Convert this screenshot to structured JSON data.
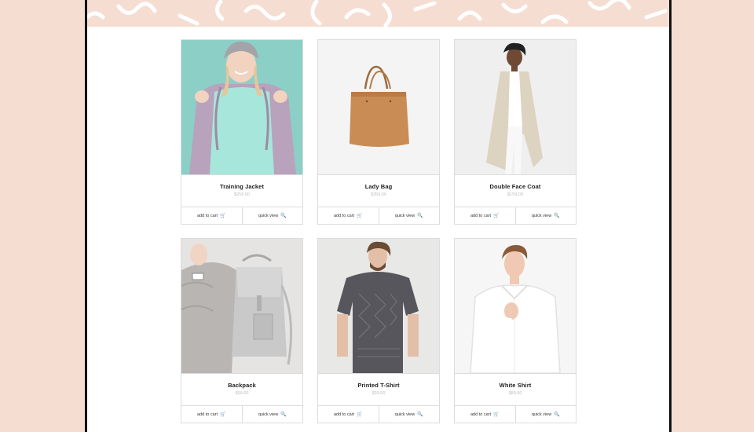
{
  "products": [
    {
      "name": "Training Jacket",
      "price": "$259.00",
      "add_to_cart": "add to cart",
      "quick_view": "quick view",
      "cart_icon": "cart-icon",
      "view_icon": "magnifier-icon"
    },
    {
      "name": "Lady Bag",
      "price": "$359.00",
      "add_to_cart": "add to cart",
      "quick_view": "quick view",
      "cart_icon": "cart-icon",
      "view_icon": "magnifier-icon"
    },
    {
      "name": "Double Face Coat",
      "price": "$159.00",
      "add_to_cart": "add to cart",
      "quick_view": "quick view",
      "cart_icon": "cart-icon",
      "view_icon": "magnifier-icon"
    },
    {
      "name": "Backpack",
      "price": "$99.00",
      "add_to_cart": "add to cart",
      "quick_view": "quick view",
      "cart_icon": "cart-icon",
      "view_icon": "magnifier-icon"
    },
    {
      "name": "Printed T-Shirt",
      "price": "$39.00",
      "add_to_cart": "add to cart",
      "quick_view": "quick view",
      "cart_icon": "cart-icon",
      "view_icon": "magnifier-icon"
    },
    {
      "name": "White Shirt",
      "price": "$89.00",
      "add_to_cart": "add to cart",
      "quick_view": "quick view",
      "cart_icon": "cart-icon",
      "view_icon": "magnifier-icon"
    }
  ],
  "colors": {
    "page_background": "#f6ddd2",
    "banner_squiggles": "#ffffff",
    "frame_border": "#111111",
    "card_border": "#dcdcdc",
    "price_text": "#bdbdbd"
  }
}
